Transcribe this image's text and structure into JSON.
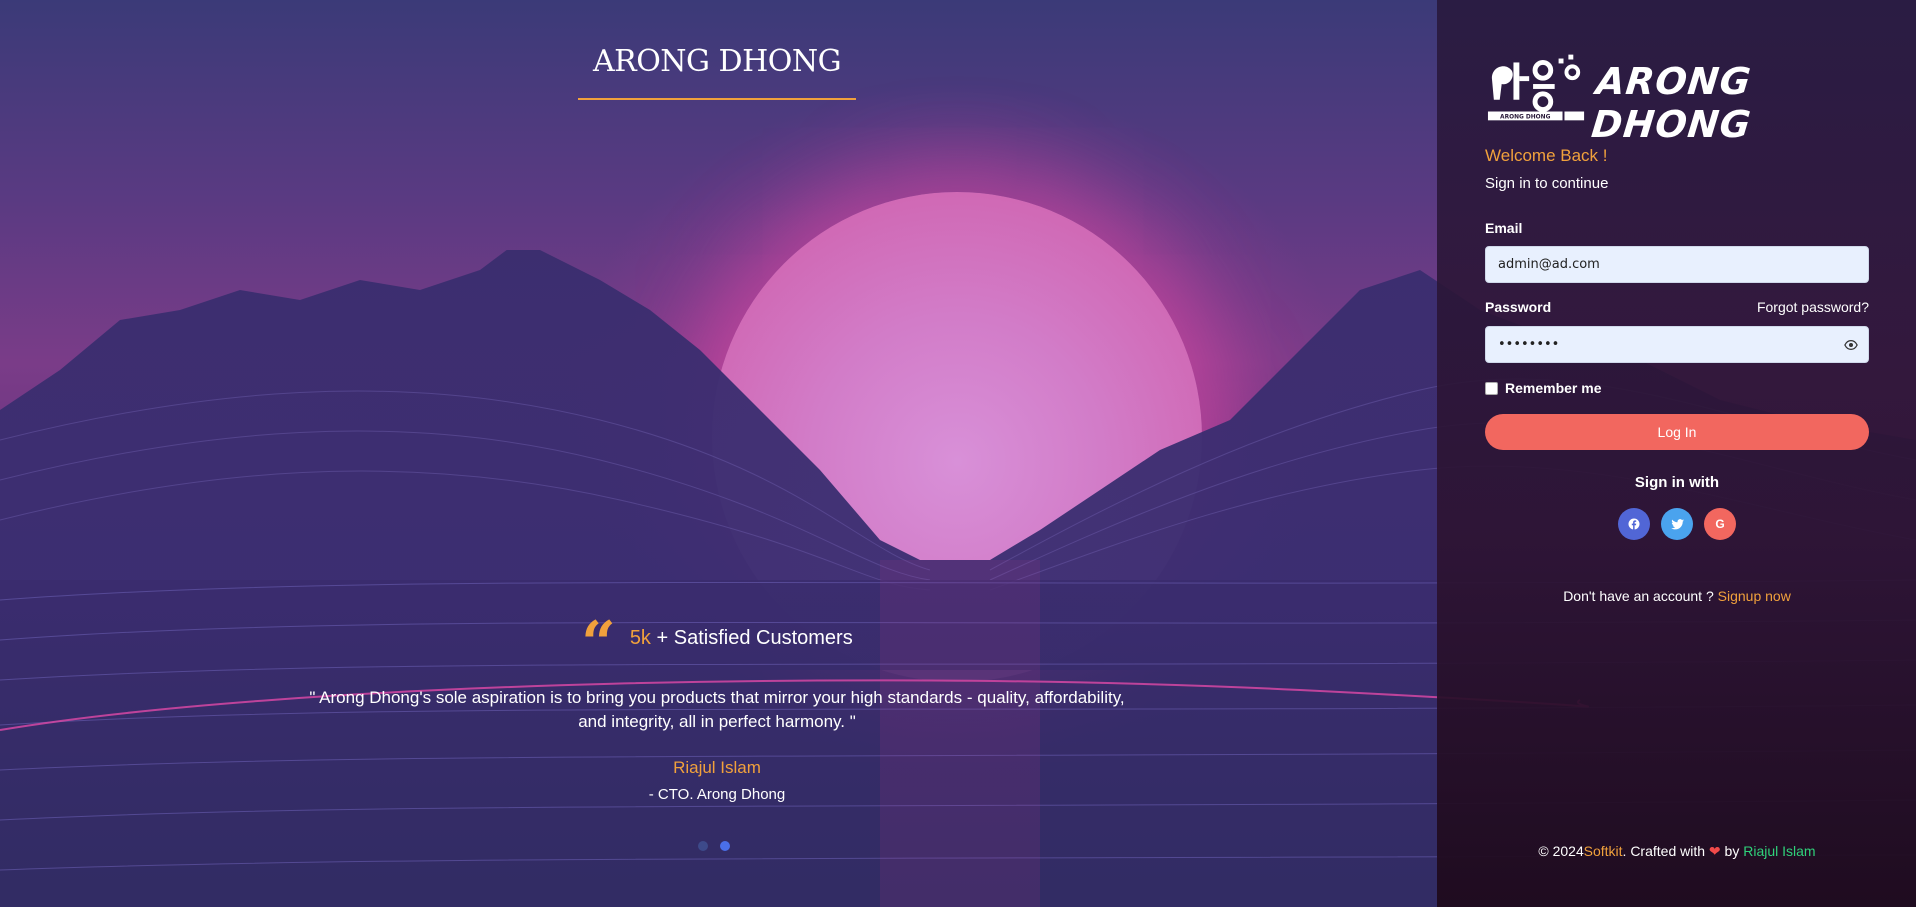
{
  "left": {
    "brand_title": "ARONG DHONG",
    "testimonial": {
      "stat_number": "5k",
      "stat_label": "+ Satisfied Customers",
      "quote": "\" Arong Dhong's sole aspiration is to bring you products that mirror your high standards - quality, affordability, and integrity, all in perfect harmony. \"",
      "author": "Riajul Islam",
      "role": "- CTO. Arong Dhong"
    },
    "carousel": {
      "count": 2,
      "active": 2
    }
  },
  "panel": {
    "logo_text": "ARONG DHONG",
    "logo_mark_caption": "ARONG DHONG",
    "welcome": "Welcome Back !",
    "subtitle": "Sign in to continue",
    "email_label": "Email",
    "email_value": "admin@ad.com",
    "password_label": "Password",
    "forgot_password": "Forgot password?",
    "password_value": "••••••••",
    "remember_label": "Remember me",
    "login_button": "Log In",
    "sign_in_with": "Sign in with",
    "socials": [
      "facebook-icon",
      "twitter-icon",
      "google-icon"
    ],
    "signup_prompt": "Don't have an account ?",
    "signup_link": "Signup now",
    "footer": {
      "prefix": "© 2024",
      "company": "Softkit",
      "crafted": ". Crafted with",
      "by": "by",
      "author": "Riajul Islam"
    }
  },
  "colors": {
    "accent_orange": "#f1a13c",
    "button_red": "#f2675f",
    "facebook": "#5166d6",
    "twitter": "#4aa3ee",
    "footer_author_green": "#2fd17a"
  }
}
